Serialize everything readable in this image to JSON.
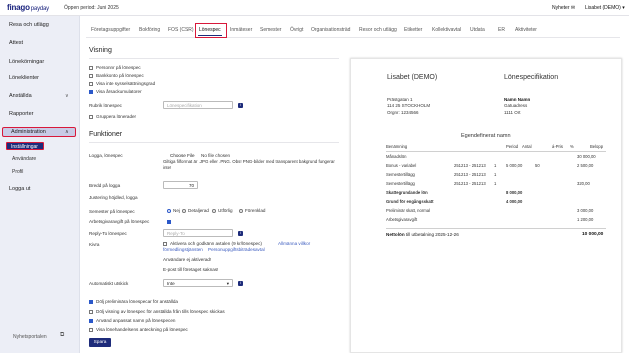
{
  "topbar": {
    "logo_main": "finago",
    "logo_sub": "payday",
    "period": "Öppen period: Juni 2025",
    "news": "Nyheter",
    "company": "Lisabet (DEMO)"
  },
  "sidebar": {
    "items": [
      {
        "label": "Resa och utlägg",
        "chevron": ""
      },
      {
        "label": "Attest",
        "chevron": ""
      },
      {
        "label": "Lönekörningar",
        "chevron": ""
      },
      {
        "label": "Löneklienter",
        "chevron": ""
      },
      {
        "label": "Anställda",
        "chevron": "∨"
      },
      {
        "label": "Rapporter",
        "chevron": ""
      },
      {
        "label": "Administration",
        "chevron": "∧"
      },
      {
        "label": "Logga ut",
        "chevron": ""
      }
    ],
    "subitems": [
      "Inställningar",
      "Användare",
      "Profil"
    ],
    "footer": "Nyhetsportalen",
    "footer_icon": "external-link-icon"
  },
  "tabs": [
    "Företagsuppgifter",
    "Bokföring",
    "FOS (CSR)",
    "Lönespec",
    "Inmäteser",
    "Semester",
    "Övrigt",
    "Organisationsträd",
    "Resor och utlägg",
    "Etiketter",
    "Kollektivavtal",
    "Utdata",
    "ER",
    "Aktiviteter"
  ],
  "active_tab": "Lönespec",
  "visning": {
    "title": "Visning",
    "checkboxes": [
      {
        "label": "Personnr på lönespec",
        "checked": false
      },
      {
        "label": "Bankkonto på lönespec",
        "checked": false
      },
      {
        "label": "Visa inte sysselsättningsgrad",
        "checked": false
      },
      {
        "label": "Visa årsackumulatorer",
        "checked": true
      }
    ],
    "rubrik_label": "Rubrik lönespec",
    "rubrik_placeholder": "Lönespecifikation",
    "grupp_label": "Gruppera lönerader"
  },
  "funktioner": {
    "title": "Funktioner",
    "logo_label": "Logga, lönespec",
    "choose_file": "Choose File",
    "no_file": "No file chosen",
    "logo_help": "Giltiga filformat är .JPG eller .PNG. Obs! PNG-bilder med transparent bakgrund fungerar inte!",
    "width_label": "Bredd på logga",
    "width_value": "70",
    "justering_label": "Justering höjdled, logga",
    "semester_label": "Semester på lönespec",
    "semester_options": [
      {
        "label": "Nej",
        "checked": true
      },
      {
        "label": "Detaljerad",
        "checked": false
      },
      {
        "label": "Utförlig",
        "checked": false
      },
      {
        "label": "Förenklad",
        "checked": false
      }
    ],
    "arbetsgivar_label": "Arbetsgivaravgift på lönespec",
    "replyto_label": "Reply-To lönespec",
    "replyto_placeholder": "Reply-To",
    "kivra_label": "Kivra",
    "kivra_text": "Aktivera och godkänn avtalen (9 kr/lönespec)",
    "kivra_link1": "Allmänna villkor",
    "kivra_link2": "förmedlingstjänsten",
    "kivra_link3": "Personuppgiftsbiträdesavtal",
    "anvandare_text": "Användare ej aktiverad!",
    "epost_text": "E-post till företaget saknas!",
    "utskick_label": "Automatiskt utskick",
    "utskick_value": "Inte",
    "bottom_checkboxes": [
      {
        "label": "Dölj preliminära lönespecar för anställda",
        "checked": true
      },
      {
        "label": "Dölj visning av lönespec för anställda från tills lönespec skickas",
        "checked": false
      },
      {
        "label": "Använd anpassat namn på lönespecen",
        "checked": true
      },
      {
        "label": "Visa lönehandelsens anteckning på lönespec",
        "checked": false
      }
    ],
    "save": "Spara"
  },
  "preview": {
    "company": "Lisabet  (DEMO)",
    "doc_title": "Lönespecifikation",
    "address": [
      "Prästgatan 1",
      "114 25 STOCKHOLM",
      "Orgnr: 1234566"
    ],
    "recipient_label": "Namn Namn",
    "recipient_lines": [
      "Gatuadress",
      "1111 Ort"
    ],
    "custom_name": "Egendefinerat namn",
    "columns": [
      "Benämning",
      "Period",
      "Antal",
      "á-Pris",
      "%",
      "Belopp"
    ],
    "rows": [
      {
        "name": "Månadslön",
        "period": "",
        "antal": "",
        "apris": "",
        "pct": "",
        "belopp": "30 000,00",
        "bold": false
      },
      {
        "name": "Bonus - variabel",
        "period": "251213 - 251213",
        "antal": "1",
        "apris": "5 000,00",
        "pct": "50",
        "belopp": "2 500,00",
        "bold": false
      },
      {
        "name": "Semestertillägg",
        "period": "251213 - 251213",
        "antal": "1",
        "apris": "",
        "pct": "",
        "belopp": "",
        "bold": false
      },
      {
        "name": "Semestertillägg",
        "period": "251213 - 251213",
        "antal": "1",
        "apris": "",
        "pct": "",
        "belopp": "320,00",
        "bold": false
      },
      {
        "name": "Skattegrundande lön",
        "period": "",
        "antal": "",
        "apris": "8 000,00",
        "pct": "",
        "belopp": "",
        "bold": true
      },
      {
        "name": "Grund för engångsskatt",
        "period": "",
        "antal": "",
        "apris": "4 000,00",
        "pct": "",
        "belopp": "",
        "bold": true
      },
      {
        "name": "Preliminär skatt, normal",
        "period": "",
        "antal": "",
        "apris": "",
        "pct": "",
        "belopp": "3 000,00",
        "bold": false
      },
      {
        "name": "Arbetsgivaravgift",
        "period": "",
        "antal": "",
        "apris": "",
        "pct": "",
        "belopp": "1 200,00",
        "bold": false
      }
    ],
    "netto_label": "Nettolön",
    "netto_text": "till utbetalning 2025-12-26",
    "netto_value": "10 000,00"
  }
}
